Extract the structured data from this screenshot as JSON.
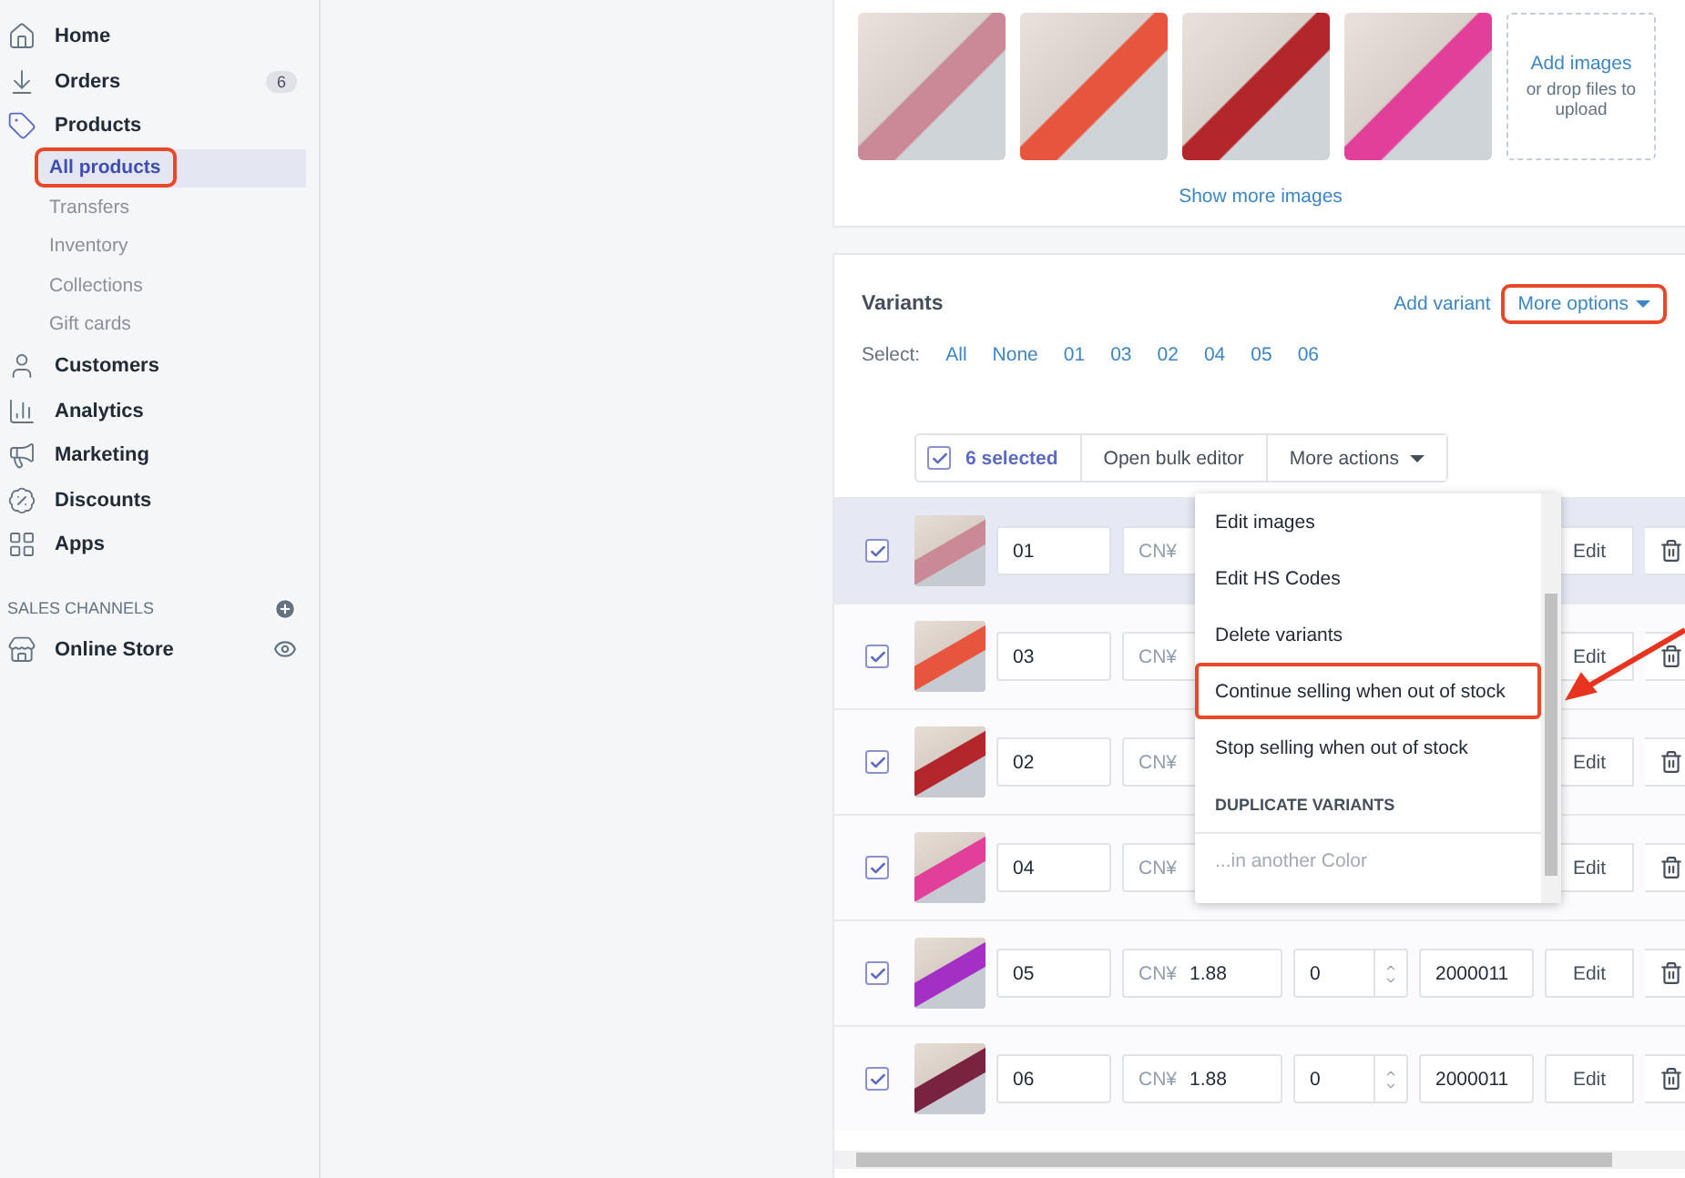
{
  "sidebar": {
    "items": [
      {
        "label": "Home",
        "selected": false
      },
      {
        "label": "Orders",
        "badge": "6",
        "selected": false
      },
      {
        "label": "Products",
        "selected": false,
        "children": [
          {
            "label": "All products",
            "selected": true,
            "annotated": true
          },
          {
            "label": "Transfers",
            "selected": false
          },
          {
            "label": "Inventory",
            "selected": false
          },
          {
            "label": "Collections",
            "selected": false
          },
          {
            "label": "Gift cards",
            "selected": false
          }
        ]
      },
      {
        "label": "Customers",
        "selected": false
      },
      {
        "label": "Analytics",
        "selected": false
      },
      {
        "label": "Marketing",
        "selected": false
      },
      {
        "label": "Discounts",
        "selected": false
      },
      {
        "label": "Apps",
        "selected": false
      }
    ],
    "section": {
      "title": "SALES CHANNELS",
      "items": [
        {
          "label": "Online Store",
          "selected": false
        }
      ]
    }
  },
  "media": {
    "images": [
      {
        "color": "#c98a96"
      },
      {
        "color": "#e8553e"
      },
      {
        "color": "#b3262c"
      },
      {
        "color": "#e23f9a"
      }
    ],
    "add_link": "Add images",
    "add_hint": "or drop files to upload",
    "more_link": "Show more images"
  },
  "variants": {
    "title": "Variants",
    "add_link": "Add variant",
    "more_options": {
      "label": "More options",
      "annotated": true
    },
    "select_label": "Select:",
    "select_links": [
      "All",
      "None",
      "01",
      "03",
      "02",
      "04",
      "05",
      "06"
    ],
    "bulk": {
      "checked": true,
      "count": "6 selected",
      "buttons": [
        "Open bulk editor",
        "More actions"
      ]
    },
    "rows": [
      {
        "checked": true,
        "highlighted": true,
        "color": "#c98a96",
        "name": "01",
        "price_prefix": "CN¥",
        "edit": "Edit"
      },
      {
        "checked": true,
        "highlighted": false,
        "color": "#e8553e",
        "name": "03",
        "price_prefix": "CN¥",
        "edit": "Edit"
      },
      {
        "checked": true,
        "highlighted": false,
        "color": "#b3262c",
        "name": "02",
        "price_prefix": "CN¥",
        "edit": "Edit"
      },
      {
        "checked": true,
        "highlighted": false,
        "color": "#e23f9a",
        "name": "04",
        "price_prefix": "CN¥",
        "edit": "Edit"
      },
      {
        "checked": true,
        "highlighted": false,
        "color": "#a42fc4",
        "name": "05",
        "price_prefix": "CN¥",
        "price": "1.88",
        "quantity": "0",
        "sku": "2000011",
        "edit": "Edit"
      },
      {
        "checked": true,
        "highlighted": false,
        "color": "#7a2340",
        "name": "06",
        "price_prefix": "CN¥",
        "price": "1.88",
        "quantity": "0",
        "sku": "2000011",
        "edit": "Edit"
      }
    ],
    "menu": [
      {
        "kind": "item",
        "label": "Edit images",
        "annotated": false
      },
      {
        "kind": "item",
        "label": "Edit HS Codes",
        "annotated": false
      },
      {
        "kind": "item",
        "label": "Delete variants",
        "annotated": false
      },
      {
        "kind": "item",
        "label": "Continue selling when out of stock",
        "annotated": true
      },
      {
        "kind": "item",
        "label": "Stop selling when out of stock",
        "annotated": false
      },
      {
        "kind": "heading",
        "label": "DUPLICATE VARIANTS",
        "annotated": false
      },
      {
        "kind": "disabled",
        "label": "...in another Color",
        "annotated": false
      }
    ]
  }
}
